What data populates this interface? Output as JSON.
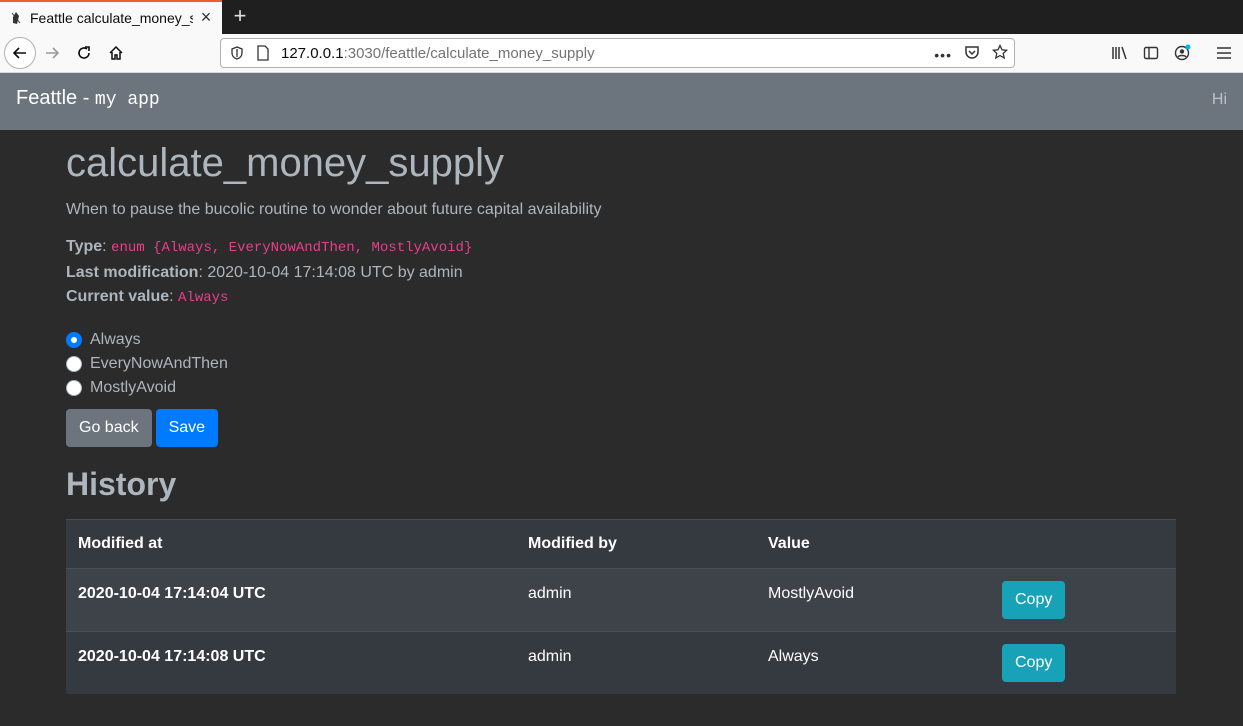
{
  "browser": {
    "tab_title": "Feattle calculate_money_supply",
    "url_host": "127.0.0.1",
    "url_rest": ":3030/feattle/calculate_money_supply"
  },
  "app": {
    "brand": "Feattle - ",
    "brand_code": "my app",
    "greeting": "Hi"
  },
  "feature": {
    "title": "calculate_money_supply",
    "description": "When to pause the bucolic routine to wonder about future capital availability",
    "type_label": "Type",
    "type_value": "enum {Always, EveryNowAndThen, MostlyAvoid}",
    "last_mod_label": "Last modification",
    "last_mod_value": ": 2020-10-04 17:14:08 UTC by admin",
    "current_label": "Current value",
    "current_value": "Always",
    "options": [
      {
        "label": "Always",
        "checked": true
      },
      {
        "label": "EveryNowAndThen",
        "checked": false
      },
      {
        "label": "MostlyAvoid",
        "checked": false
      }
    ]
  },
  "actions": {
    "back_label": "Go back",
    "save_label": "Save"
  },
  "history": {
    "title": "History",
    "columns": [
      "Modified at",
      "Modified by",
      "Value",
      ""
    ],
    "copy_label": "Copy",
    "rows": [
      {
        "modified_at": "2020-10-04 17:14:04 UTC",
        "modified_by": "admin",
        "value": "MostlyAvoid"
      },
      {
        "modified_at": "2020-10-04 17:14:08 UTC",
        "modified_by": "admin",
        "value": "Always"
      }
    ]
  },
  "colors": {
    "primary": "#007bff",
    "secondary": "#6c757d",
    "info": "#17a2b8",
    "code": "#e83e8c"
  }
}
